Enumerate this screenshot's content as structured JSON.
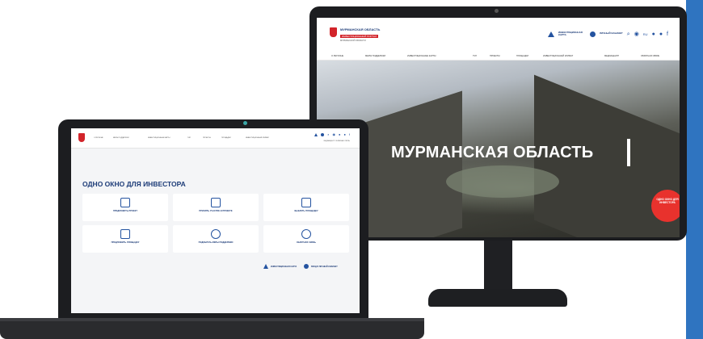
{
  "monitor": {
    "logo": {
      "line1": "МУРМАНСКАЯ ОБЛАСТЬ",
      "line2": "ИНВЕСТИЦИОННЫЙ ПОРТАЛ",
      "line3": "МУРМАНСКОЙ ОБЛАСТИ"
    },
    "utility": {
      "investment_map": "ИНВЕСТИЦИОННАЯ КАРТА",
      "personal_account": "ЛИЧНЫЙ КАБИНЕТ",
      "lang": "RU"
    },
    "nav": [
      "О РЕГИОНЕ",
      "МЕРЫ ПОДДЕРЖКИ",
      "ИНВЕСТИЦИОННЫЕ КАРТЫ",
      "ГЧП",
      "ПРОЕКТЫ",
      "ПЛОЩАДКИ",
      "ИНВЕСТИЦИОННЫЙ КЛИМАТ",
      "МЕДИАЦЕНТР",
      "ОБРАТНАЯ СВЯЗЬ"
    ],
    "hero_title": "МУРМАНСКАЯ ОБЛАСТЬ",
    "cta": "ОДНО ОКНО ДЛЯ ИНВЕСТОРА"
  },
  "laptop": {
    "nav": [
      "О РЕГИОНЕ",
      "МЕРЫ ПОДДЕРЖКИ",
      "ИНВЕСТИЦИОННЫЕ КАРТЫ",
      "ГЧП",
      "ПРОЕКТЫ",
      "ПЛОЩАДКИ",
      "ИНВЕСТИЦИОННЫЙ КЛИМАТ"
    ],
    "util_labels": "МЕДИАЦЕНТР   ОБРАТНАЯ СВЯЗЬ",
    "title": "ОДНО ОКНО ДЛЯ ИНВЕСТОРА",
    "cards": [
      "ПРЕДЛОЖИТЬ ПРОЕКТ",
      "ПРИНЯТЬ УЧАСТИЕ В ПРОЕКТЕ",
      "ВЫБРАТЬ ПЛОЩАДКУ",
      "ПРЕДЛОЖИТЬ ПЛОЩАДКУ",
      "ПОДОБРАТЬ МЕРЫ ПОДДЕРЖКИ",
      "ОБРАТНАЯ СВЯЗЬ"
    ],
    "footer": {
      "investment_map": "ИНВЕСТИЦИОННАЯ КАРТА",
      "personal_account": "ВХОД В ЛИЧНЫЙ КАБИНЕТ"
    }
  },
  "colors": {
    "accent": "#2f74c0",
    "brand_blue": "#1d3c78",
    "brand_red": "#d2242a",
    "cta_red": "#e8322d"
  }
}
